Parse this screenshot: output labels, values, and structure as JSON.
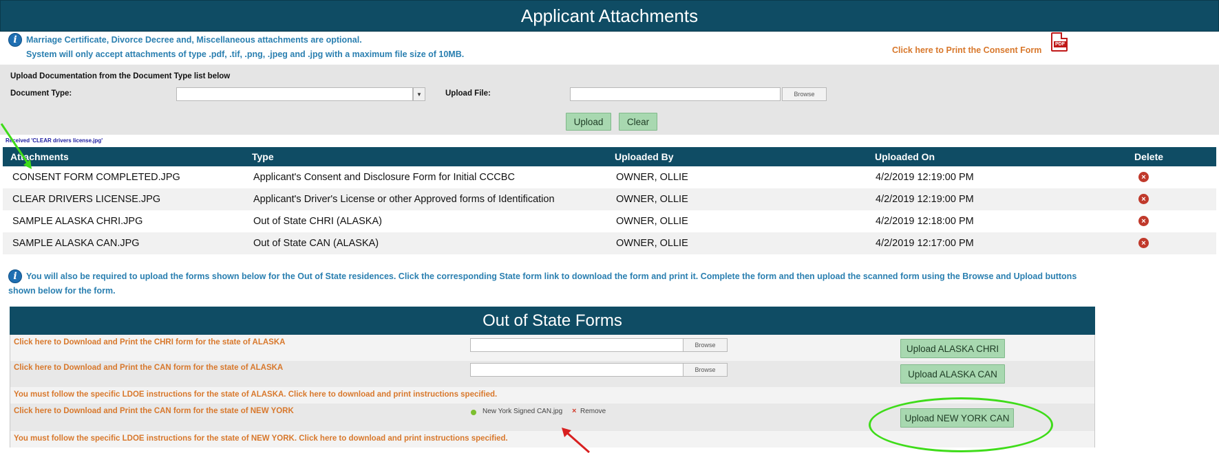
{
  "header": {
    "title": "Applicant Attachments"
  },
  "info": {
    "line1": "Marriage Certificate, Divorce Decree and, Miscellaneous attachments are optional.",
    "line2": "System will only accept attachments of type .pdf, .tif, .png, .jpeg and .jpg with a maximum file size of 10MB.",
    "consent_link": "Click here to Print the Consent Form",
    "pdf_icon_text": "PDF"
  },
  "upload": {
    "heading": "Upload Documentation from the Document Type list below",
    "doc_type_label": "Document Type:",
    "doc_type_value": "",
    "upload_file_label": "Upload File:",
    "upload_file_value": "",
    "browse_label": "Browse",
    "upload_btn": "Upload",
    "clear_btn": "Clear"
  },
  "saved_message": "Received 'CLEAR drivers license.jpg'",
  "table": {
    "headers": [
      "Attachments",
      "Type",
      "Uploaded By",
      "Uploaded On",
      "Delete"
    ],
    "rows": [
      {
        "attachment": "CONSENT FORM COMPLETED.JPG",
        "type": "Applicant's Consent and Disclosure Form for Initial CCCBC",
        "by": "OWNER, OLLIE",
        "on": "4/2/2019 12:19:00 PM"
      },
      {
        "attachment": "CLEAR DRIVERS LICENSE.JPG",
        "type": "Applicant's Driver's License or other Approved forms of Identification",
        "by": "OWNER, OLLIE",
        "on": "4/2/2019 12:19:00 PM"
      },
      {
        "attachment": "SAMPLE ALASKA CHRI.JPG",
        "type": "Out of State CHRI (ALASKA)",
        "by": "OWNER, OLLIE",
        "on": "4/2/2019 12:18:00 PM"
      },
      {
        "attachment": "SAMPLE ALASKA CAN.JPG",
        "type": "Out of State CAN (ALASKA)",
        "by": "OWNER, OLLIE",
        "on": "4/2/2019 12:17:00 PM"
      }
    ]
  },
  "note2": {
    "line1": "You will also be required to upload the forms shown below for the Out of State residences. Click the corresponding State form link to download the form and print it. Complete the form and then upload the scanned form using the Browse and Upload buttons",
    "line2": "shown below for the form."
  },
  "oos": {
    "title": "Out of State Forms",
    "browse_label": "Browse",
    "rows": [
      {
        "link": "Click here to Download and Print the CHRI form for the state of ALASKA",
        "button": "Upload ALASKA CHRI"
      },
      {
        "link": "Click here to Download and Print the CAN form for the state of ALASKA",
        "button": "Upload ALASKA CAN"
      },
      {
        "instruction": "You must follow the specific LDOE instructions for the state of ALASKA. Click here to download and print instructions specified."
      },
      {
        "link": "Click here to Download and Print the CAN form for the state of NEW YORK",
        "file": "New York Signed CAN.jpg",
        "remove": "Remove",
        "button": "Upload NEW YORK CAN"
      },
      {
        "instruction": "You must follow the specific LDOE instructions for the state of NEW YORK. Click here to download and print instructions specified."
      }
    ]
  },
  "colors": {
    "header_bg": "#0f4c64",
    "info_text": "#2a7fb0",
    "link_orange": "#d8782c",
    "button_green": "#a8d8b0",
    "annotation_green": "#3fdc1a",
    "annotation_red": "#d81f1f"
  },
  "icons": [
    "info-icon",
    "pdf-icon",
    "delete-icon",
    "dropdown-arrow-icon",
    "file-ok-icon",
    "remove-x-icon"
  ]
}
